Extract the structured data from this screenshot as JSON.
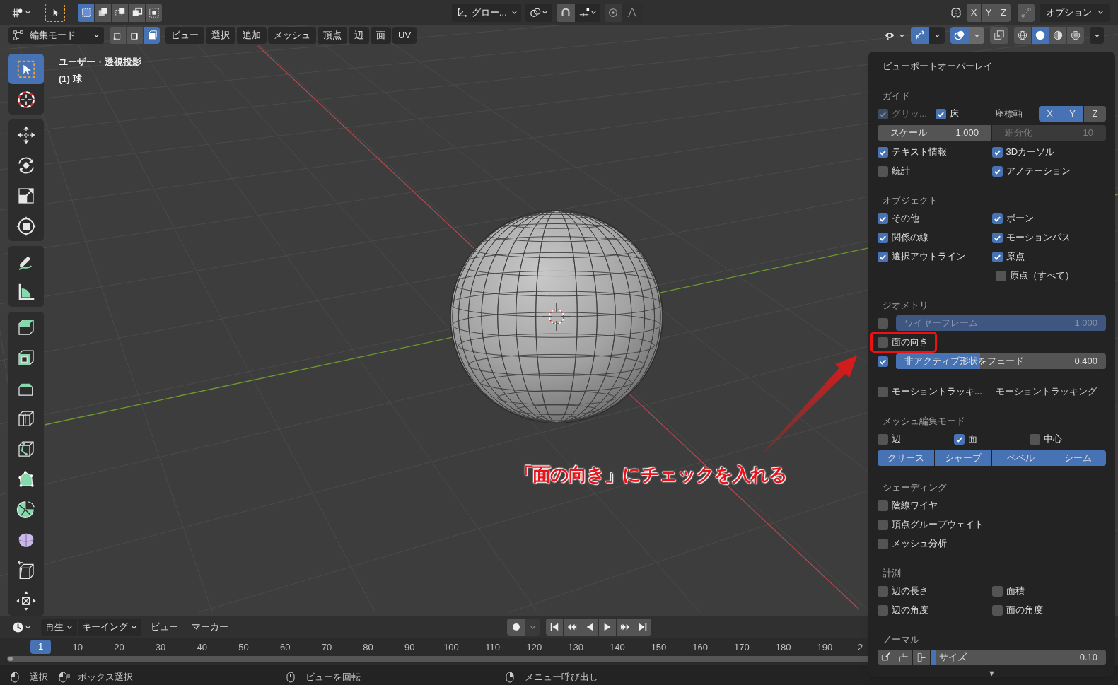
{
  "header": {
    "select_modes": [
      {
        "selected": true
      },
      {
        "selected": false
      },
      {
        "selected": false
      },
      {
        "selected": false
      },
      {
        "selected": false
      }
    ],
    "transform_orientation": "グロー...",
    "axis_toggles": [
      {
        "label": "X",
        "selected": false
      },
      {
        "label": "Y",
        "selected": false
      },
      {
        "label": "Z",
        "selected": false
      }
    ],
    "options": "オプション",
    "mode": "編集モード",
    "element_modes": [
      {
        "selected": false
      },
      {
        "selected": false
      },
      {
        "selected": true
      }
    ],
    "menus": [
      "ビュー",
      "選択",
      "追加",
      "メッシュ",
      "頂点",
      "辺",
      "面",
      "UV"
    ],
    "viewport_toggles": [
      {
        "kind": "visibility",
        "selected": false
      },
      {
        "kind": "gizmo",
        "selected": true
      },
      {
        "kind": "overlay",
        "selected": true
      },
      {
        "kind": "xray",
        "selected": false
      }
    ],
    "shading_modes": [
      {
        "selected": false
      },
      {
        "selected": true
      },
      {
        "selected": false
      },
      {
        "selected": false
      }
    ]
  },
  "tools": [
    {
      "kind": "select",
      "selected": true
    },
    {
      "kind": "cursor",
      "selected": false
    },
    {
      "kind": "move",
      "selected": false
    },
    {
      "kind": "rotate",
      "selected": false
    },
    {
      "kind": "scale",
      "selected": false
    },
    {
      "kind": "transform",
      "selected": false
    },
    {
      "kind": "annotate",
      "selected": false
    },
    {
      "kind": "measure",
      "selected": false
    },
    {
      "kind": "extrude",
      "selected": false
    },
    {
      "kind": "inset",
      "selected": false
    },
    {
      "kind": "bevel",
      "selected": false
    },
    {
      "kind": "loopcut",
      "selected": false
    },
    {
      "kind": "knife",
      "selected": false
    },
    {
      "kind": "polybuild",
      "selected": false
    },
    {
      "kind": "spin",
      "selected": false
    },
    {
      "kind": "smooth",
      "selected": false
    },
    {
      "kind": "shear",
      "selected": false
    },
    {
      "kind": "push",
      "selected": false
    }
  ],
  "viewport": {
    "view_name": "ユーザー・透視投影",
    "object_name": "(1) 球"
  },
  "annotation": {
    "text": "「面の向き」にチェックを入れる"
  },
  "overlay_panel": {
    "title": "ビューポートオーバーレイ",
    "sections": [
      {
        "title": "ガイド",
        "rows": [
          {
            "kind": "axes",
            "checks": [
              {
                "label": "グリッ...",
                "checked": true,
                "disabled": true
              },
              {
                "label": "床",
                "checked": true,
                "disabled": false
              }
            ],
            "label": "座標軸",
            "buttons": [
              {
                "label": "X",
                "selected": true
              },
              {
                "label": "Y",
                "selected": true
              },
              {
                "label": "Z",
                "selected": false
              }
            ]
          },
          {
            "kind": "fields",
            "fields": [
              {
                "label": "スケール",
                "value": "1.000",
                "disabled": false
              },
              {
                "label": "細分化",
                "value": "10",
                "disabled": true
              }
            ]
          },
          {
            "kind": "checks",
            "items": [
              {
                "label": "テキスト情報",
                "checked": true
              },
              {
                "label": "3Dカーソル",
                "checked": true
              }
            ]
          },
          {
            "kind": "checks",
            "items": [
              {
                "label": "統計",
                "checked": false
              },
              {
                "label": "アノテーション",
                "checked": true
              }
            ]
          }
        ]
      },
      {
        "title": "オブジェクト",
        "rows": [
          {
            "kind": "checks",
            "items": [
              {
                "label": "その他",
                "checked": true
              },
              {
                "label": "ボーン",
                "checked": true
              }
            ]
          },
          {
            "kind": "checks",
            "items": [
              {
                "label": "関係の線",
                "checked": true
              },
              {
                "label": "モーションパス",
                "checked": true
              }
            ]
          },
          {
            "kind": "checks",
            "items": [
              {
                "label": "選択アウトライン",
                "checked": true
              },
              {
                "label": "原点",
                "checked": true
              }
            ]
          },
          {
            "kind": "checks_right",
            "items": [
              {
                "label": "原点（すべて）",
                "checked": false
              }
            ]
          }
        ]
      },
      {
        "title": "ジオメトリ",
        "rows": [
          {
            "kind": "check_slider",
            "checked": false,
            "label": "ワイヤーフレーム",
            "value": "1.000",
            "level": 1,
            "disabled": true
          },
          {
            "kind": "check",
            "checked": false,
            "label": "面の向き",
            "highlighted": true
          },
          {
            "kind": "check_slider",
            "checked": true,
            "label": "非アクティブ形状をフェード",
            "value": "0.400",
            "level": 0.4,
            "disabled": false
          }
        ]
      },
      {
        "rows": [
          {
            "kind": "check_dropdown",
            "checked": false,
            "label": "モーショントラッキ...",
            "option": "モーショントラッキング"
          }
        ]
      },
      {
        "title": "メッシュ編集モード",
        "rows": [
          {
            "kind": "checks",
            "items": [
              {
                "label": "辺",
                "checked": false
              },
              {
                "label": "面",
                "checked": true
              },
              {
                "label": "中心",
                "checked": false
              }
            ]
          },
          {
            "kind": "segmented",
            "buttons": [
              {
                "label": "クリース",
                "selected": true
              },
              {
                "label": "シャープ",
                "selected": true
              },
              {
                "label": "ベベル",
                "selected": true
              },
              {
                "label": "シーム",
                "selected": true
              }
            ]
          }
        ]
      },
      {
        "title": "シェーディング",
        "rows": [
          {
            "kind": "checks",
            "items": [
              {
                "label": "陰線ワイヤ",
                "checked": false
              }
            ]
          },
          {
            "kind": "checks",
            "items": [
              {
                "label": "頂点グループウェイト",
                "checked": false
              }
            ]
          },
          {
            "kind": "checks",
            "items": [
              {
                "label": "メッシュ分析",
                "checked": false
              }
            ]
          }
        ]
      },
      {
        "title": "計測",
        "rows": [
          {
            "kind": "checks",
            "items": [
              {
                "label": "辺の長さ",
                "checked": false
              },
              {
                "label": "面積",
                "checked": false
              }
            ]
          },
          {
            "kind": "checks",
            "items": [
              {
                "label": "辺の角度",
                "checked": false
              },
              {
                "label": "面の角度",
                "checked": false
              }
            ]
          }
        ]
      },
      {
        "title": "ノーマル",
        "rows": [
          {
            "kind": "normals",
            "label": "サイズ",
            "value": "0.10",
            "level": 0.03
          }
        ]
      }
    ],
    "more_indicator": "▼"
  },
  "timeline": {
    "menus": [
      {
        "label": "再生",
        "dropdown": true
      },
      {
        "label": "キーイング",
        "dropdown": true
      },
      {
        "label": "ビュー",
        "dropdown": false
      },
      {
        "label": "マーカー",
        "dropdown": false
      }
    ],
    "current_frame": "1",
    "frame_labels": [
      "10",
      "20",
      "30",
      "40",
      "50",
      "60",
      "70",
      "80",
      "90",
      "100",
      "110",
      "120",
      "130",
      "140",
      "150",
      "160",
      "170",
      "180",
      "190",
      "2"
    ]
  },
  "status_bar": [
    {
      "kind": "left",
      "text": "選択"
    },
    {
      "kind": "left_drag",
      "text": "ボックス選択"
    },
    {
      "kind": "middle",
      "text": "ビューを回転"
    },
    {
      "kind": "right",
      "text": "メニュー呼び出し"
    }
  ]
}
